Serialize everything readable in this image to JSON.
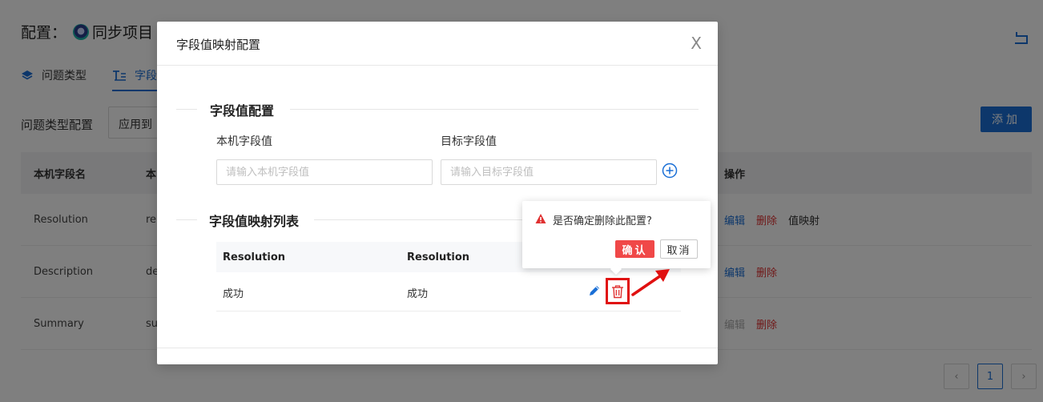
{
  "page": {
    "title_prefix": "配置：",
    "project_name": "同步项目",
    "tabs": [
      {
        "label": "问题类型",
        "icon": "layers-icon",
        "active": false
      },
      {
        "label": "字段",
        "icon": "text-field-icon",
        "active": true
      }
    ],
    "filter_label": "问题类型配置",
    "filter_value": "应用到",
    "add_label": "添加",
    "table": {
      "columns": [
        "本机字段名",
        "本",
        "操作"
      ],
      "rows": [
        {
          "local": "Resolution",
          "target": "re",
          "actions": [
            "编辑",
            "删除",
            "值映射"
          ],
          "edit_disabled": false
        },
        {
          "local": "Description",
          "target": "de",
          "actions": [
            "编辑",
            "删除"
          ],
          "edit_disabled": false
        },
        {
          "local": "Summary",
          "target": "su",
          "actions": [
            "编辑",
            "删除"
          ],
          "edit_disabled": true
        }
      ]
    },
    "pagination": {
      "prev": "‹",
      "current": "1",
      "next": "›"
    }
  },
  "modal": {
    "title": "字段值映射配置",
    "close": "X",
    "section_config": "字段值配置",
    "local_label": "本机字段值",
    "target_label": "目标字段值",
    "local_placeholder": "请输入本机字段值",
    "target_placeholder": "请输入目标字段值",
    "section_list": "字段值映射列表",
    "table": {
      "columns": [
        "Resolution",
        "Resolution"
      ],
      "rows": [
        {
          "local": "成功",
          "target": "成功"
        }
      ]
    }
  },
  "popconfirm": {
    "message": "是否确定删除此配置?",
    "ok": "确认",
    "cancel": "取消"
  },
  "colors": {
    "primary": "#1a6fd6",
    "danger": "#e03131",
    "confirm": "#f04848",
    "highlight": "#e01010"
  }
}
